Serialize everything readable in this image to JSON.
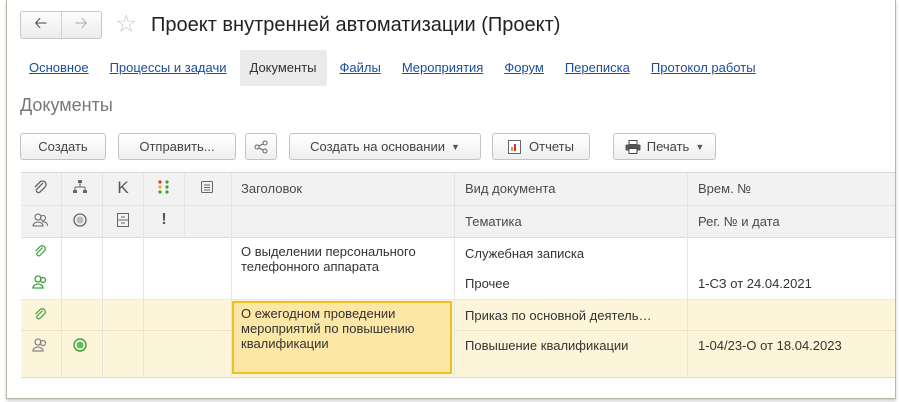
{
  "window": {
    "title": "Проект внутренней автоматизации (Проект)",
    "back_icon": "arrow-left-icon",
    "forward_icon": "arrow-right-icon",
    "favorite_icon": "star-icon"
  },
  "tabs": [
    {
      "label": "Основное",
      "active": false
    },
    {
      "label": "Процессы и задачи",
      "active": false
    },
    {
      "label": "Документы",
      "active": true
    },
    {
      "label": "Файлы",
      "active": false
    },
    {
      "label": "Мероприятия",
      "active": false
    },
    {
      "label": "Форум",
      "active": false
    },
    {
      "label": "Переписка",
      "active": false
    },
    {
      "label": "Протокол работы",
      "active": false
    }
  ],
  "section_title": "Документы",
  "toolbar": {
    "create": "Создать",
    "send": "Отправить...",
    "share_icon": "share-icon",
    "create_based": "Создать на основании",
    "reports": "Отчеты",
    "print": "Печать"
  },
  "table": {
    "header_icons_row1": [
      "clip-icon",
      "hierarchy-icon",
      "K-letter-icon",
      "traffic-light-icon",
      "list-icon"
    ],
    "header_icons_row2": [
      "users-icon",
      "circle-status-icon",
      "cabinet-icon",
      "exclamation-icon"
    ],
    "k_label": "K",
    "exclamation": "!",
    "columns": {
      "title": "Заголовок",
      "doc_type": "Вид документа",
      "temp_no": "Врем. №",
      "topic": "Тематика",
      "reg_no": "Рег. № и дата"
    },
    "rows": [
      {
        "title": "О выделении персонального телефонного аппарата",
        "doc_type": "Служебная записка",
        "temp_no": "",
        "topic": "Прочее",
        "reg_no": "1-СЗ от 24.04.2021",
        "status_icon": false
      },
      {
        "title": "О ежегодном проведении мероприятий по повышению квалификации",
        "doc_type": "Приказ по основной деятель…",
        "temp_no": "",
        "topic": "Повышение квалификации",
        "reg_no": "1-04/23-О от 18.04.2023",
        "status_icon": true
      }
    ]
  },
  "colors": {
    "link": "#1a4d9c",
    "selection_row": "#fdf5d9",
    "selection_cell": "#fce7a6",
    "selection_border": "#f0c020",
    "green_icon": "#3aa03a"
  }
}
